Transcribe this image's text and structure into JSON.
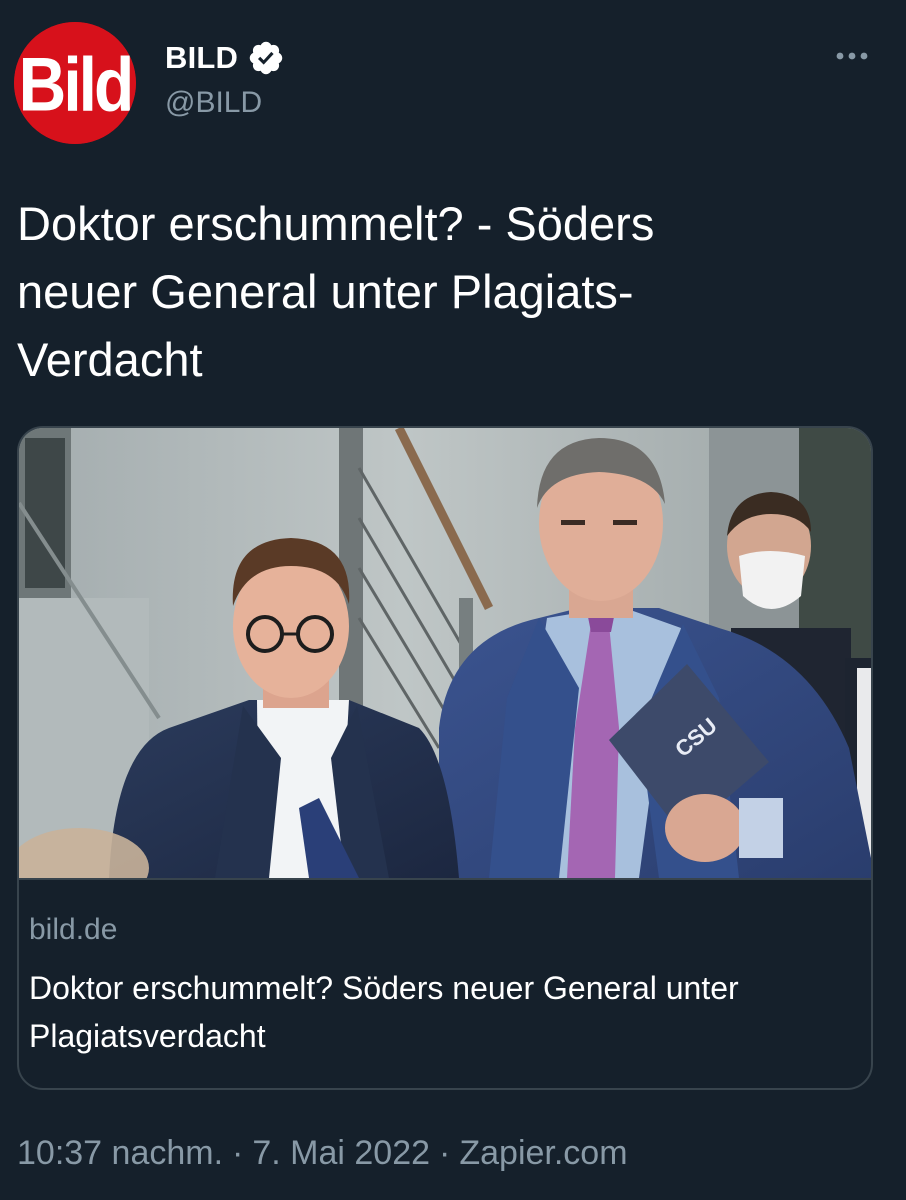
{
  "author": {
    "display_name": "BILD",
    "handle": "@BILD",
    "avatar_logo": "Bild",
    "verified": true,
    "avatar_color": "#d7111b"
  },
  "tweet": {
    "text": "Doktor erschummelt? - Söders\nneuer General unter Plagiats-\nVerdacht"
  },
  "card": {
    "image_icon": "photo-image",
    "domain": "bild.de",
    "title": "Doktor erschummelt? Söders neuer General unter Plagiatsverdacht",
    "folder_text": "CSU"
  },
  "meta": {
    "time": "10:37 nachm.",
    "separator": "·",
    "date": "7. Mai 2022",
    "source": "Zapier.com"
  },
  "icons": {
    "more": "more-horizontal-icon",
    "verified": "verified-badge-icon"
  },
  "colors": {
    "background": "#15202b",
    "text_secondary": "#8899a6",
    "border": "#38444d",
    "verified_badge": "#ffffff"
  }
}
